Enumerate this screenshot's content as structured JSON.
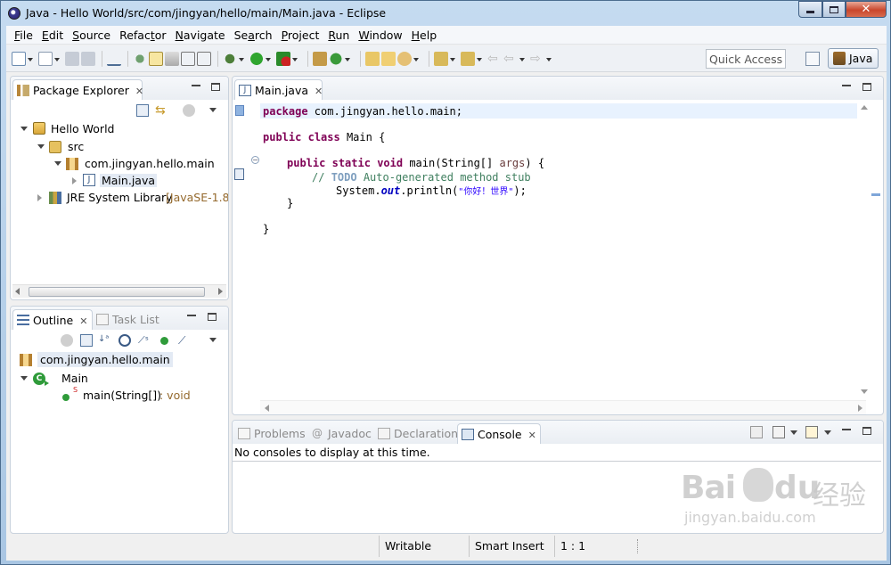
{
  "window": {
    "title": "Java - Hello World/src/com/jingyan/hello/main/Main.java - Eclipse",
    "buttons": [
      "minimize",
      "maximize",
      "close"
    ]
  },
  "menubar": {
    "items": [
      {
        "label": "File",
        "mnemonic": "F",
        "rest": "ile"
      },
      {
        "label": "Edit",
        "mnemonic": "E",
        "rest": "dit"
      },
      {
        "label": "Source",
        "mnemonic": "S",
        "rest": "ource"
      },
      {
        "label": "Refactor",
        "pre": "Refac",
        "mnemonic": "t",
        "rest": "or"
      },
      {
        "label": "Navigate",
        "mnemonic": "N",
        "rest": "avigate"
      },
      {
        "label": "Search",
        "pre": "Se",
        "mnemonic": "a",
        "rest": "rch"
      },
      {
        "label": "Project",
        "mnemonic": "P",
        "rest": "roject"
      },
      {
        "label": "Run",
        "mnemonic": "R",
        "rest": "un"
      },
      {
        "label": "Window",
        "mnemonic": "W",
        "rest": "indow"
      },
      {
        "label": "Help",
        "mnemonic": "H",
        "rest": "elp"
      }
    ]
  },
  "toolbar": {
    "quick_access_placeholder": "Quick Access",
    "perspective_label": "Java"
  },
  "package_explorer": {
    "tab_label": "Package Explorer",
    "tree": {
      "project": "Hello World",
      "src": "src",
      "package": "com.jingyan.hello.main",
      "file": "Main.java",
      "jre_label": "JRE System Library",
      "jre_decoration": "[JavaSE-1.8]"
    }
  },
  "outline": {
    "tab_label": "Outline",
    "tab2_label": "Task List",
    "package": "com.jingyan.hello.main",
    "class": "Main",
    "method": "main(String[])",
    "method_type": ": void",
    "method_static_marker": "S"
  },
  "editor": {
    "tab_label": "Main.java",
    "lines": {
      "l1_kw": "package",
      "l1_rest": " com.jingyan.hello.main;",
      "l3_kw1": "public",
      "l3_kw2": "class",
      "l3_rest": " Main {",
      "l5_kw1": "public",
      "l5_kw2": "static",
      "l5_kw3": "void",
      "l5_rest1": " main(String[] ",
      "l5_param": "args",
      "l5_rest2": ") {",
      "l6_cm1": "// ",
      "l6_todo": "TODO",
      "l6_cm2": " Auto-generated method stub",
      "l7_a": "System.",
      "l7_fld": "out",
      "l7_b": ".println(",
      "l7_str": "\"你好！世界\"",
      "l7_c": ");",
      "l8": "}",
      "l10": "}"
    }
  },
  "bottom_panel": {
    "tabs": [
      "Problems",
      "Javadoc",
      "Declaration",
      "Console"
    ],
    "active_tab": "Console",
    "message": "No consoles to display at this time."
  },
  "statusbar": {
    "writable": "Writable",
    "insert_mode": "Smart Insert",
    "position": "1 : 1"
  },
  "watermark": {
    "main": "Bai",
    "paw": "du",
    "cn": "经验",
    "url": "jingyan.baidu.com"
  }
}
